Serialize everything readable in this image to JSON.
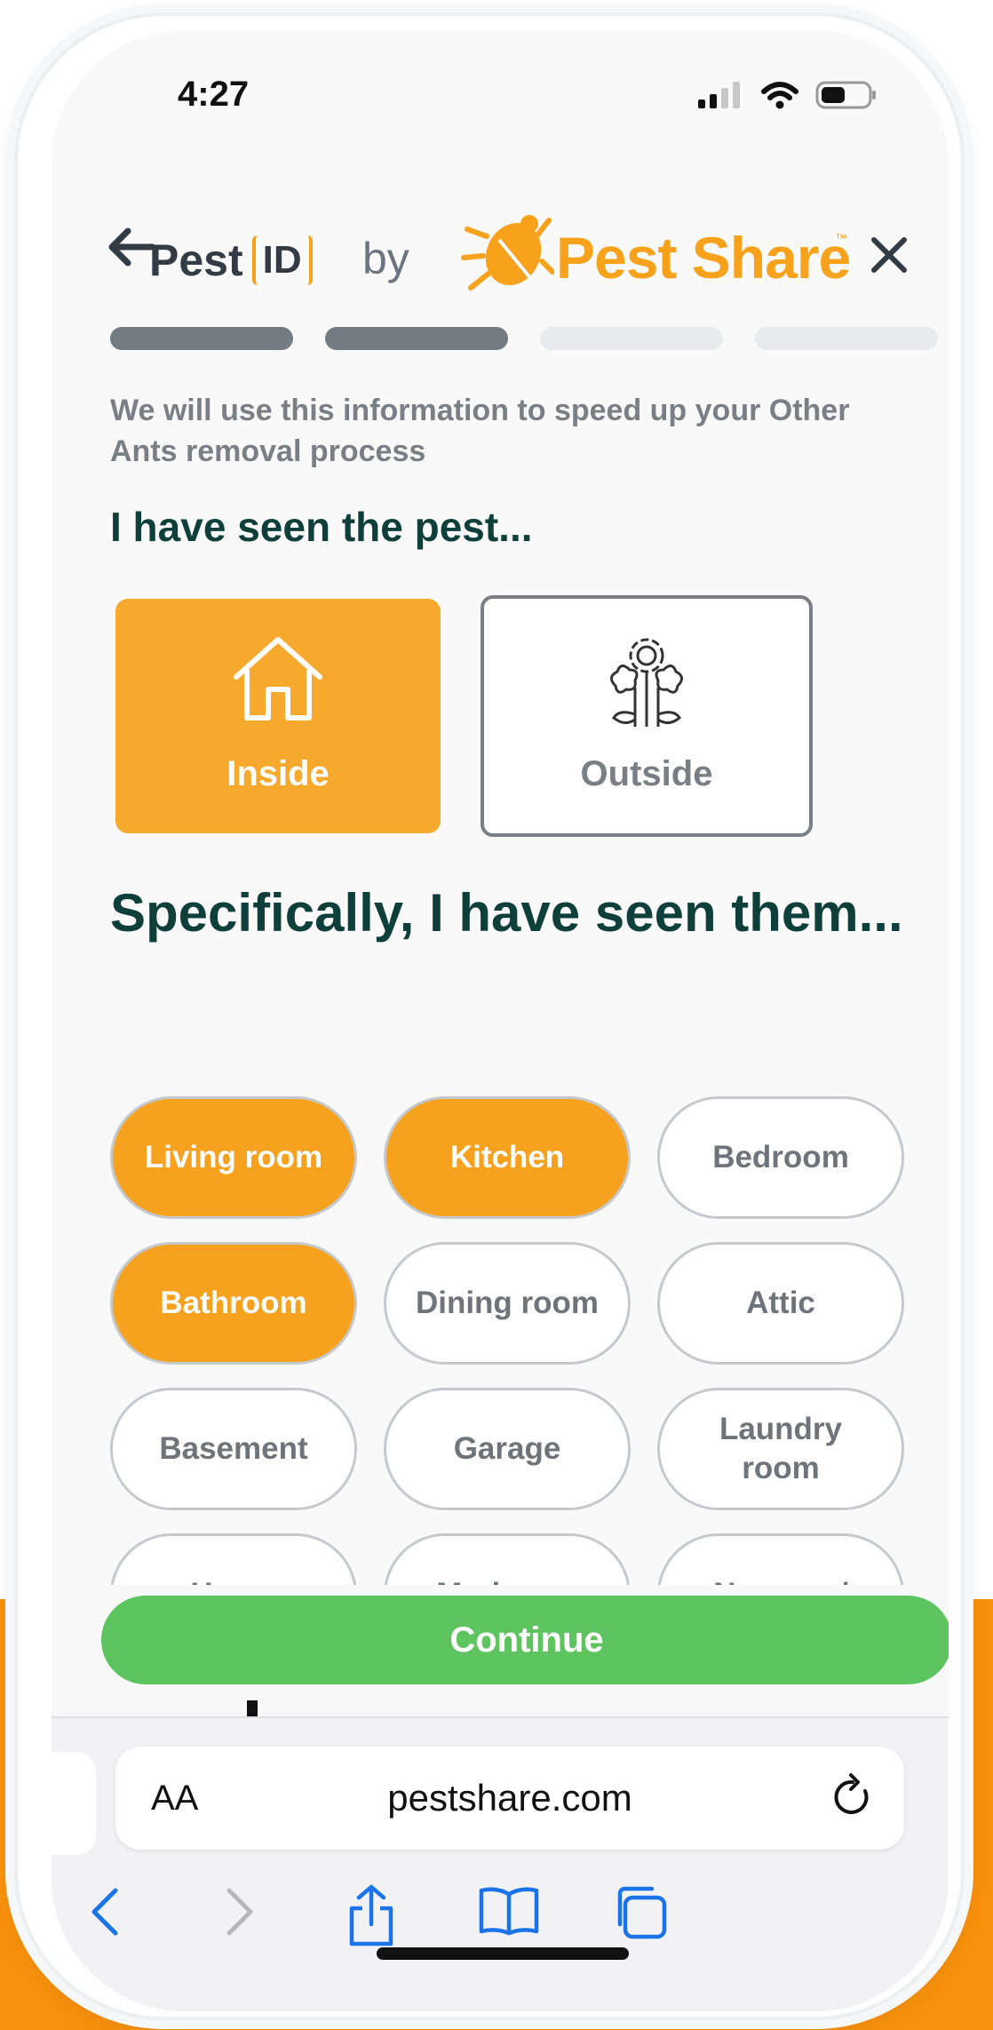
{
  "status": {
    "time": "4:27"
  },
  "header": {
    "logo_pest": "Pest",
    "logo_id": "ID",
    "by": "by",
    "brand": "Pest Share",
    "tm": "™"
  },
  "progress": {
    "total_steps": 4,
    "completed_steps": 2
  },
  "intro": "We will use this information to speed up your Other Ants removal process",
  "section_title": "I have seen the pest...",
  "locations": [
    {
      "label": "Inside",
      "icon": "house-icon",
      "selected": true
    },
    {
      "label": "Outside",
      "icon": "flowers-icon",
      "selected": false
    }
  ],
  "sub_title": "Specifically, I have seen them...",
  "rooms": [
    {
      "label": "Living room",
      "selected": true
    },
    {
      "label": "Kitchen",
      "selected": true
    },
    {
      "label": "Bedroom",
      "selected": false
    },
    {
      "label": "Bathroom",
      "selected": true
    },
    {
      "label": "Dining room",
      "selected": false
    },
    {
      "label": "Attic",
      "selected": false
    },
    {
      "label": "Basement",
      "selected": false
    },
    {
      "label": "Garage",
      "selected": false
    },
    {
      "label": "Laundry room",
      "selected": false
    },
    {
      "label": "Home",
      "selected": false
    },
    {
      "label": "Mudroom",
      "selected": false
    },
    {
      "label": "Nursery /",
      "selected": false
    }
  ],
  "continue_label": "Continue",
  "browser": {
    "aa_label": "AA",
    "url": "pestshare.com"
  },
  "colors": {
    "accent": "#f6a21e",
    "heading": "#0f3f3a",
    "continue": "#5ec45f",
    "ios_blue": "#1a73e8"
  }
}
